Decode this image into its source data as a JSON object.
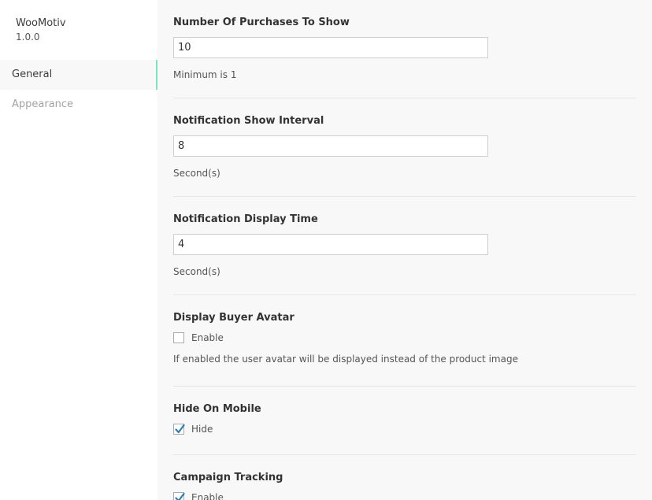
{
  "sidebar": {
    "brand_name": "WooMotiv",
    "version": "1.0.0",
    "items": [
      {
        "label": "General",
        "active": true
      },
      {
        "label": "Appearance",
        "active": false
      }
    ]
  },
  "settings": {
    "purchases": {
      "label": "Number Of Purchases To Show",
      "value": "10",
      "hint": "Minimum is 1"
    },
    "interval": {
      "label": "Notification Show Interval",
      "value": "8",
      "hint": "Second(s)"
    },
    "display_time": {
      "label": "Notification Display Time",
      "value": "4",
      "hint": "Second(s)"
    },
    "buyer_avatar": {
      "label": "Display Buyer Avatar",
      "checkbox_label": "Enable",
      "checked": false,
      "hint": "If enabled the user avatar will be displayed instead of the product image"
    },
    "hide_mobile": {
      "label": "Hide On Mobile",
      "checkbox_label": "Hide",
      "checked": true
    },
    "campaign_tracking": {
      "label": "Campaign Tracking",
      "checkbox_label": "Enable",
      "checked": true
    }
  },
  "colors": {
    "accent": "#7ce6c4",
    "check": "#2a7fb8"
  }
}
